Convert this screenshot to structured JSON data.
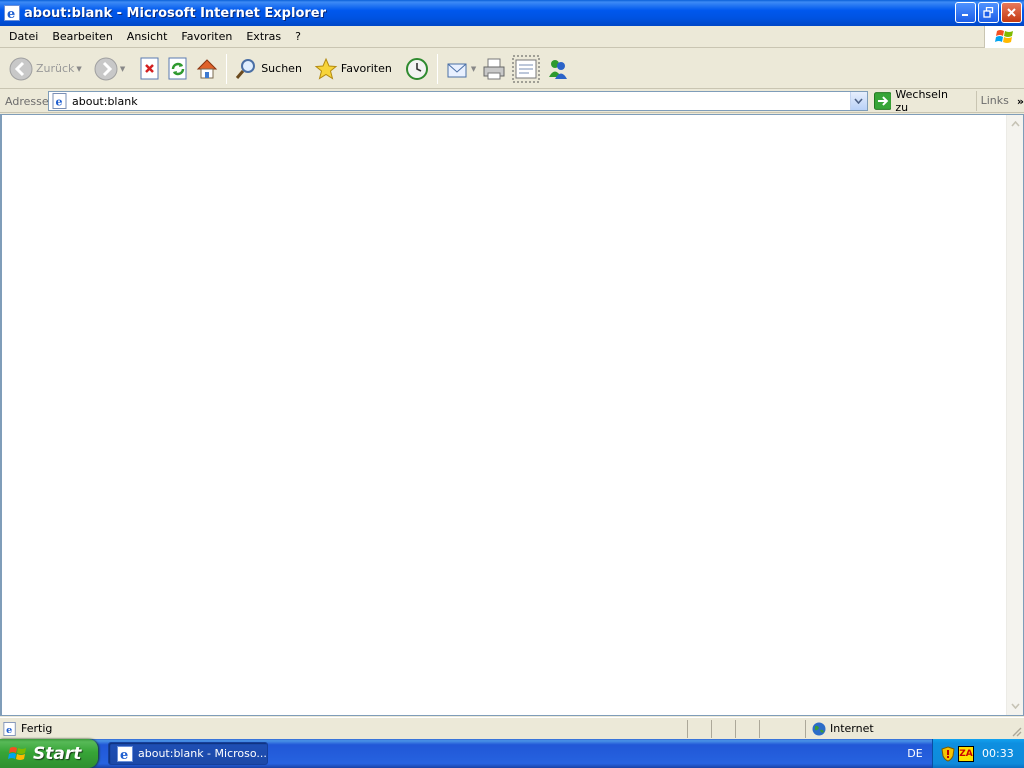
{
  "window": {
    "title": "about:blank - Microsoft Internet Explorer",
    "app_icon": "ie-icon",
    "controls": [
      "minimize-icon",
      "restore-icon",
      "close-icon"
    ]
  },
  "menubar": {
    "items": [
      "Datei",
      "Bearbeiten",
      "Ansicht",
      "Favoriten",
      "Extras",
      "?"
    ]
  },
  "toolbar": {
    "back_label": "Zurück",
    "search_label": "Suchen",
    "favorites_label": "Favoriten"
  },
  "address": {
    "label": "Adresse",
    "value": "about:blank",
    "go_label": "Wechseln zu",
    "links_label": "Links",
    "more": "»"
  },
  "statusbar": {
    "status": "Fertig",
    "zone": "Internet"
  },
  "taskbar": {
    "start_label": "Start",
    "task_label": "about:blank - Microso...",
    "language": "DE",
    "clock": "00:33"
  },
  "colors": {
    "titlebar": "#0058ee",
    "taskbar": "#2663e0",
    "start_button": "#37a537",
    "tray": "#0f8bdb"
  }
}
